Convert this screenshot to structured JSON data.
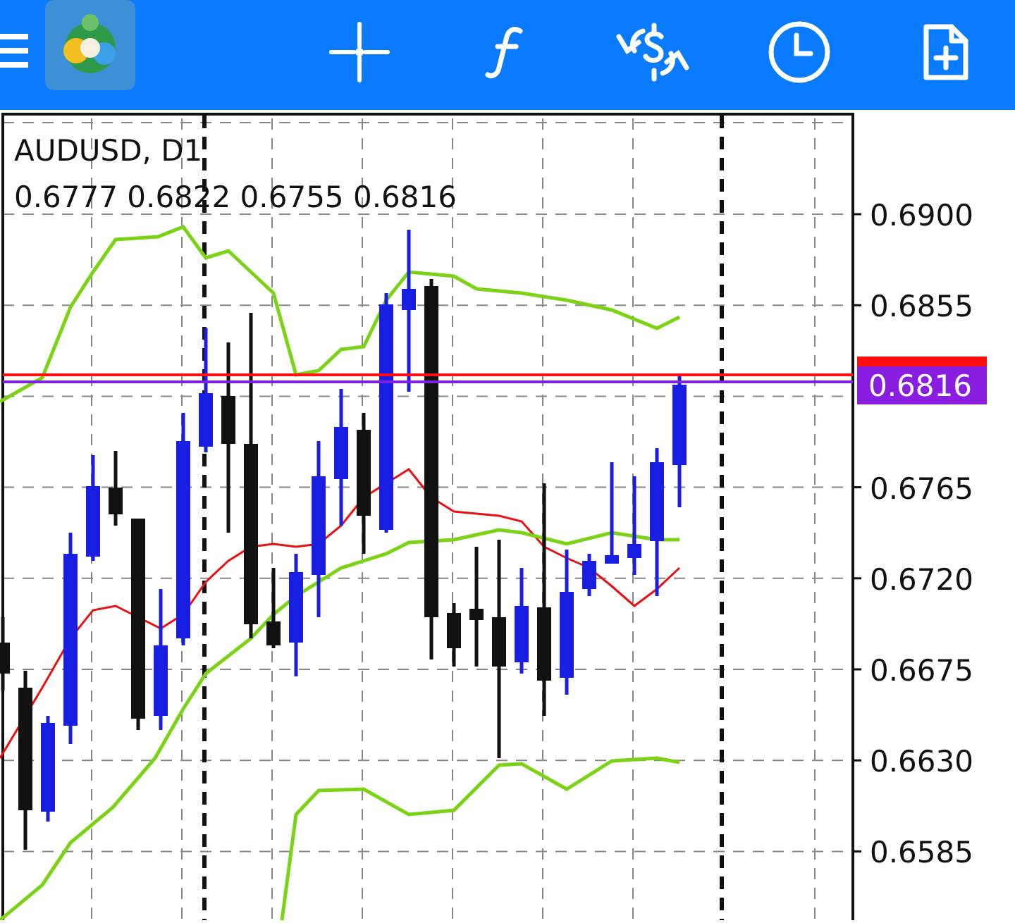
{
  "toolbar": {
    "items": [
      {
        "kind": "crosshair"
      },
      {
        "kind": "function"
      },
      {
        "kind": "trade"
      },
      {
        "kind": "period"
      },
      {
        "kind": "new-order"
      }
    ]
  },
  "chart": {
    "title": "AUDUSD, D1",
    "ohlc": "0.6777 0.6822 0.6755 0.6816",
    "price_axis": [
      "0.6900",
      "0.6855",
      "0.6765",
      "0.6720",
      "0.6675",
      "0.6630",
      "0.6585"
    ],
    "price_tag": "0.6816"
  }
}
